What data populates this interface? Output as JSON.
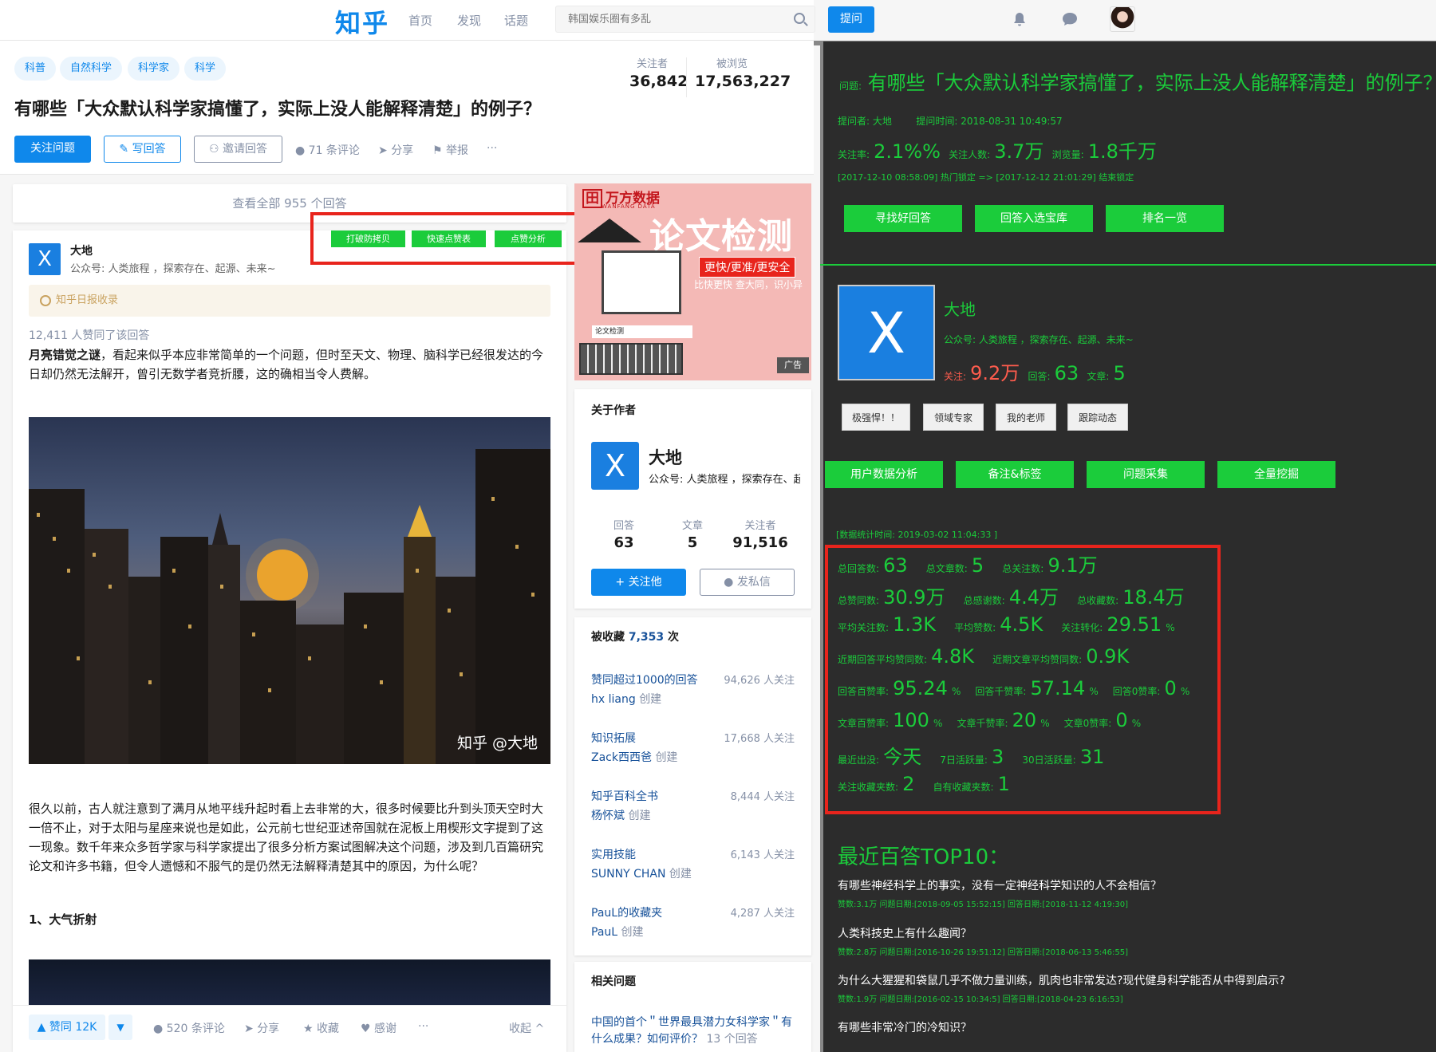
{
  "nav": {
    "logo": "知乎",
    "links": [
      "首页",
      "发现",
      "话题"
    ],
    "search_placeholder": "韩国娱乐圈有多乱",
    "ask_label": "提问"
  },
  "question": {
    "tags": [
      "科普",
      "自然科学",
      "科学家",
      "科学"
    ],
    "title": "有哪些「大众默认科学家搞懂了，实际上没人能解释清楚」的例子？",
    "followers_label": "关注者",
    "followers": "36,842",
    "views_label": "被浏览",
    "views": "17,563,227",
    "follow_btn": "关注问题",
    "write_btn": "写回答",
    "invite_btn": "邀请回答",
    "comments": "71 条评论",
    "share": "分享",
    "report": "举报",
    "more": "···"
  },
  "answers": {
    "view_all": "查看全部 955 个回答",
    "author_initial": "X",
    "author_name": "大地",
    "author_bio": "公众号: 人类旅程 ，探索存在、起源、未来~",
    "plugin_buttons": [
      "打破防拷贝",
      "快速点赞表",
      "点赞分析"
    ],
    "daily_badge": "知乎日报收录",
    "vote_line": "12,411 人赞同了该回答",
    "para1_bold": "月亮错觉之谜",
    "para1": "，看起来似乎本应非常简单的一个问题，但时至天文、物理、脑科学已经很发达的今日却仍然无法解开，曾引无数学者竞折腰，这的确相当令人费解。",
    "watermark": "知乎 @大地",
    "para2": "很久以前，古人就注意到了满月从地平线升起时看上去非常的大，很多时候要比升到头顶天空时大一倍不止，对于太阳与星座来说也是如此，公元前七世纪亚述帝国就在泥板上用楔形文字提到了这一现象。数千年来众多哲学家与科学家提出了很多分析方案试图解决这个问题，涉及到几百篇研究论文和许多书籍，但令人遗憾和不服气的是仍然无法解释清楚其中的原因，为什么呢？",
    "section1": "1、大气折射",
    "upvote": "▲ 赞同 12K",
    "downvote": "▼",
    "comments": "520 条评论",
    "share": "分享",
    "collect": "收藏",
    "thanks": "感谢",
    "more": "···",
    "collapse": "收起 ^"
  },
  "ad": {
    "brand": "万方数据",
    "brand_sub": "WANFANG DATA",
    "title": "论文检测",
    "red_line": "更快/更准/更安全",
    "gray_line": "比快更快  查大同，识小异",
    "search_text": "论文检测",
    "tag": "广告"
  },
  "about": {
    "title": "关于作者",
    "initial": "X",
    "name": "大地",
    "bio": "公众号: 人类旅程 ，探索存在、起源、未来~",
    "answers_label": "回答",
    "answers": "63",
    "articles_label": "文章",
    "articles": "5",
    "followers_label": "关注者",
    "followers": "91,516",
    "follow_btn": "+ 关注他",
    "msg_btn": "发私信"
  },
  "collections": {
    "title": "被收藏",
    "count": "7,353",
    "unit": "次",
    "items": [
      {
        "name": "赞同超过1000的回答",
        "creator": "hx liang",
        "followers": "94,626 人关注"
      },
      {
        "name": "知识拓展",
        "creator": "Zack西西爸",
        "followers": "17,668 人关注"
      },
      {
        "name": "知乎百科全书",
        "creator": "杨怀斌",
        "followers": "8,444 人关注"
      },
      {
        "name": "实用技能",
        "creator": "SUNNY CHAN",
        "followers": "6,143 人关注"
      },
      {
        "name": "PauL的收藏夹",
        "creator": "PauL",
        "followers": "4,287 人关注"
      }
    ],
    "created_label": "创建"
  },
  "related": {
    "title": "相关问题",
    "q1": "中国的首个＂世界最具潜力女科学家＂有什么成果？如何评价？",
    "q1_count": "13 个回答"
  },
  "panel": {
    "q_prefix": "问题:",
    "q_title": "有哪些「大众默认科学家搞懂了，实际上没人能解释清楚」的例子？",
    "asker_line": "提问者: 大地        提问时间: 2018-08-31 10:49:57",
    "follow_rate_k": "关注率:",
    "follow_rate_v": "2.1%%",
    "followers_k": "关注人数:",
    "followers_v": "3.7万",
    "views_k": "浏览量:",
    "views_v": "1.8千万",
    "lock_line": "[2017-12-10 08:58:09] 热门锁定 => [2017-12-12 21:01:29] 结束锁定",
    "btns1": [
      "寻找好回答",
      "回答入选宝库",
      "排名一览"
    ],
    "author_initial": "X",
    "author_name": "大地",
    "author_bio": "公众号: 人类旅程 ，探索存在、起源、未来~",
    "a_follow_k": "关注:",
    "a_follow_v": "9.2万",
    "a_answers_k": "回答:",
    "a_answers_v": "63",
    "a_articles_k": "文章:",
    "a_articles_v": "5",
    "wbtns": [
      "极强悍！！",
      "领域专家",
      "我的老师",
      "跟踪动态"
    ],
    "btns2": [
      "用户数据分析",
      "备注&标签",
      "问题采集",
      "全量挖掘"
    ],
    "stat_time": "[数据统计时间: 2019-03-02 11:04:33 ]",
    "metrics": [
      [
        {
          "k": "总回答数:",
          "v": "63",
          "u": ""
        },
        {
          "k": "总文章数:",
          "v": "5",
          "u": ""
        },
        {
          "k": "总关注数:",
          "v": "9.1万",
          "u": ""
        }
      ],
      [
        {
          "k": "总赞同数:",
          "v": "30.9万",
          "u": ""
        },
        {
          "k": "总感谢数:",
          "v": "4.4万",
          "u": ""
        },
        {
          "k": "总收藏数:",
          "v": "18.4万",
          "u": ""
        }
      ],
      [
        {
          "k": "平均关注数:",
          "v": "1.3K",
          "u": ""
        },
        {
          "k": "平均赞数:",
          "v": "4.5K",
          "u": ""
        },
        {
          "k": "关注转化:",
          "v": "29.51",
          "u": "%"
        }
      ],
      [
        {
          "k": "近期回答平均赞同数:",
          "v": "4.8K",
          "u": ""
        },
        {
          "k": "近期文章平均赞同数:",
          "v": "0.9K",
          "u": ""
        }
      ],
      [
        {
          "k": "回答百赞率:",
          "v": "95.24",
          "u": "%"
        },
        {
          "k": "回答千赞率:",
          "v": "57.14",
          "u": "%"
        },
        {
          "k": "回答0赞率:",
          "v": "0",
          "u": "%"
        }
      ],
      [
        {
          "k": "文章百赞率:",
          "v": "100",
          "u": "%"
        },
        {
          "k": "文章千赞率:",
          "v": "20",
          "u": "%"
        },
        {
          "k": "文章0赞率:",
          "v": "0",
          "u": "%"
        }
      ],
      [
        {
          "k": "最近出没:",
          "v": "今天",
          "u": ""
        },
        {
          "k": "7日活跃量:",
          "v": "3",
          "u": ""
        },
        {
          "k": "30日活跃量:",
          "v": "31",
          "u": ""
        }
      ],
      [
        {
          "k": "关注收藏夹数:",
          "v": "2",
          "u": ""
        },
        {
          "k": "自有收藏夹数:",
          "v": "1",
          "u": ""
        }
      ]
    ],
    "top10_title": "最近百答TOP10：",
    "top10": [
      {
        "q": "有哪些神经科学上的事实，没有一定神经科学知识的人不会相信？",
        "meta": "赞数:3.1万  问题日期:[2018-09-05 15:52:15]  回答日期:[2018-11-12 4:19:30]"
      },
      {
        "q": "人类科技史上有什么趣闻？",
        "meta": "赞数:2.8万  问题日期:[2016-10-26 19:51:12]  回答日期:[2018-06-13 5:46:55]"
      },
      {
        "q": "为什么大猩猩和袋鼠几乎不做力量训练，肌肉也非常发达?现代健身科学能否从中得到启示?",
        "meta": "赞数:1.9万  问题日期:[2016-02-15 10:34:5]  回答日期:[2018-04-23 6:16:53]"
      },
      {
        "q": "有哪些非常冷门的冷知识？",
        "meta": ""
      }
    ]
  }
}
